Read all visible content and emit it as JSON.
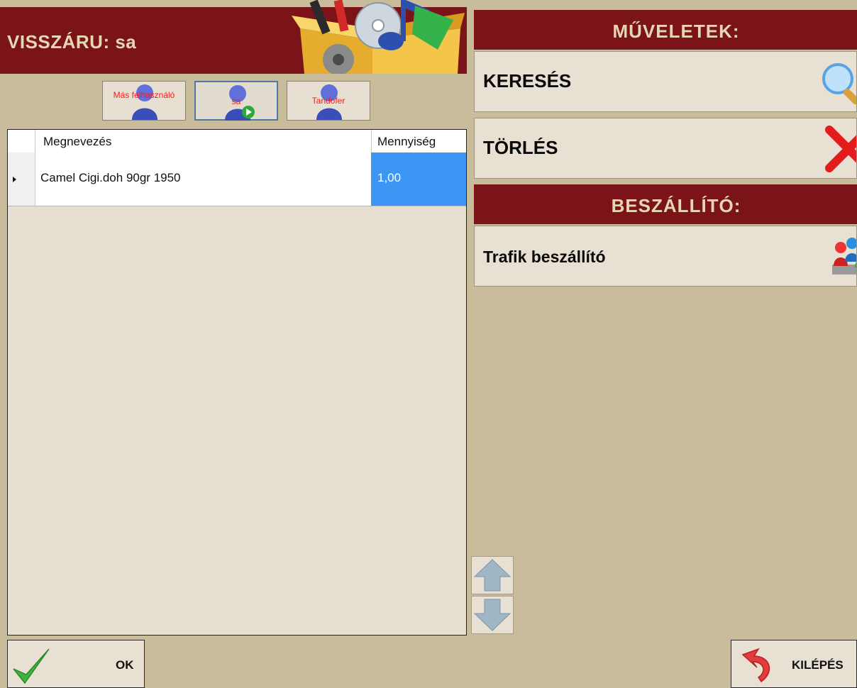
{
  "header": {
    "title": "VISSZÁRU: sa"
  },
  "users": [
    {
      "label": "Más felhasználó",
      "selected": false
    },
    {
      "label": "sa",
      "selected": true
    },
    {
      "label": "Tandofer",
      "selected": false
    }
  ],
  "grid": {
    "columns": [
      "Megnevezés",
      "Mennyiség"
    ],
    "rows": [
      {
        "name": "Camel Cigi.doh 90gr 1950",
        "qty": "1,00"
      }
    ]
  },
  "operations": {
    "header": "MŰVELETEK:",
    "search_label": "KERESÉS",
    "delete_label": "TÖRLÉS"
  },
  "supplier": {
    "header": "BESZÁLLÍTÓ:",
    "name": "Trafik beszállító"
  },
  "bottom": {
    "ok_label": "OK",
    "exit_label": "KILÉPÉS"
  },
  "colors": {
    "header_bg": "#7b1418",
    "header_text": "#e6d7b4",
    "background": "#c8bc9a",
    "panel": "#e6dfd2",
    "selection": "#3d96f4",
    "user_label": "#ff1a1a"
  },
  "icons": {
    "logo": "software-box-icon",
    "users": "user-icon",
    "search": "magnifier-icon",
    "delete": "red-x-icon",
    "supplier": "people-group-icon",
    "scroll_up": "arrow-up-icon",
    "scroll_down": "arrow-down-icon",
    "ok": "checkmark-icon",
    "exit": "undo-arrow-icon"
  }
}
